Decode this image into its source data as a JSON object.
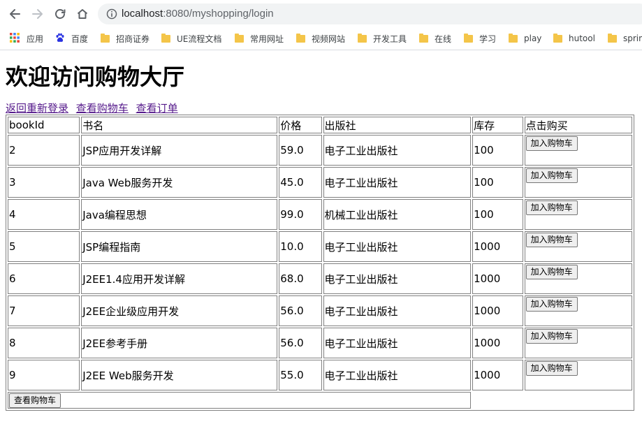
{
  "browser": {
    "url_host": "localhost",
    "url_path": ":8080/myshopping/login",
    "bookmarks": [
      {
        "label": "应用",
        "kind": "apps"
      },
      {
        "label": "百度",
        "kind": "baidu"
      },
      {
        "label": "招商证券",
        "kind": "folder"
      },
      {
        "label": "UE流程文档",
        "kind": "folder"
      },
      {
        "label": "常用网址",
        "kind": "folder"
      },
      {
        "label": "视频网站",
        "kind": "folder"
      },
      {
        "label": "开发工具",
        "kind": "folder"
      },
      {
        "label": "在线",
        "kind": "folder"
      },
      {
        "label": "学习",
        "kind": "folder"
      },
      {
        "label": "play",
        "kind": "folder"
      },
      {
        "label": "hutool",
        "kind": "folder"
      },
      {
        "label": "sprin",
        "kind": "folder"
      }
    ]
  },
  "page": {
    "title": "欢迎访问购物大厅",
    "links": {
      "relogin": "返回重新登录",
      "view_cart": "查看购物车",
      "view_orders": "查看订单"
    },
    "table": {
      "headers": [
        "bookId",
        "书名",
        "价格",
        "出版社",
        "库存",
        "点击购买"
      ],
      "add_button_label": "加入购物车",
      "rows": [
        {
          "id": "2",
          "name": "JSP应用开发详解",
          "price": "59.0",
          "publisher": "电子工业出版社",
          "stock": "100"
        },
        {
          "id": "3",
          "name": "Java Web服务开发",
          "price": "45.0",
          "publisher": "电子工业出版社",
          "stock": "100"
        },
        {
          "id": "4",
          "name": "Java编程思想",
          "price": "99.0",
          "publisher": "机械工业出版社",
          "stock": "100"
        },
        {
          "id": "5",
          "name": "JSP编程指南",
          "price": "10.0",
          "publisher": "电子工业出版社",
          "stock": "1000"
        },
        {
          "id": "6",
          "name": "J2EE1.4应用开发详解",
          "price": "68.0",
          "publisher": "电子工业出版社",
          "stock": "1000"
        },
        {
          "id": "7",
          "name": "J2EE企业级应用开发",
          "price": "56.0",
          "publisher": "电子工业出版社",
          "stock": "1000"
        },
        {
          "id": "8",
          "name": "J2EE参考手册",
          "price": "56.0",
          "publisher": "电子工业出版社",
          "stock": "1000"
        },
        {
          "id": "9",
          "name": "J2EE Web服务开发",
          "price": "55.0",
          "publisher": "电子工业出版社",
          "stock": "1000"
        }
      ],
      "footer_button_label": "查看购物车"
    }
  }
}
